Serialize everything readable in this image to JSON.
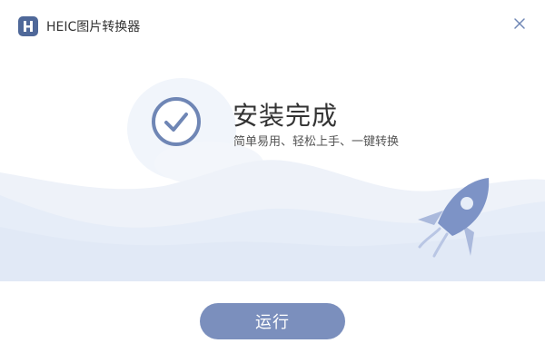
{
  "window": {
    "app_title": "HEIC图片转换器",
    "logo_letter": "H"
  },
  "status": {
    "title": "安装完成",
    "subtitle": "简单易用、轻松上手、一键转换"
  },
  "actions": {
    "run_label": "运行"
  },
  "colors": {
    "accent": "#7b8fbd",
    "logo": "#4f6899",
    "wave": "#e8eef8"
  },
  "icons": [
    "app-logo-icon",
    "close-icon",
    "check-circle-icon",
    "rocket-icon"
  ]
}
